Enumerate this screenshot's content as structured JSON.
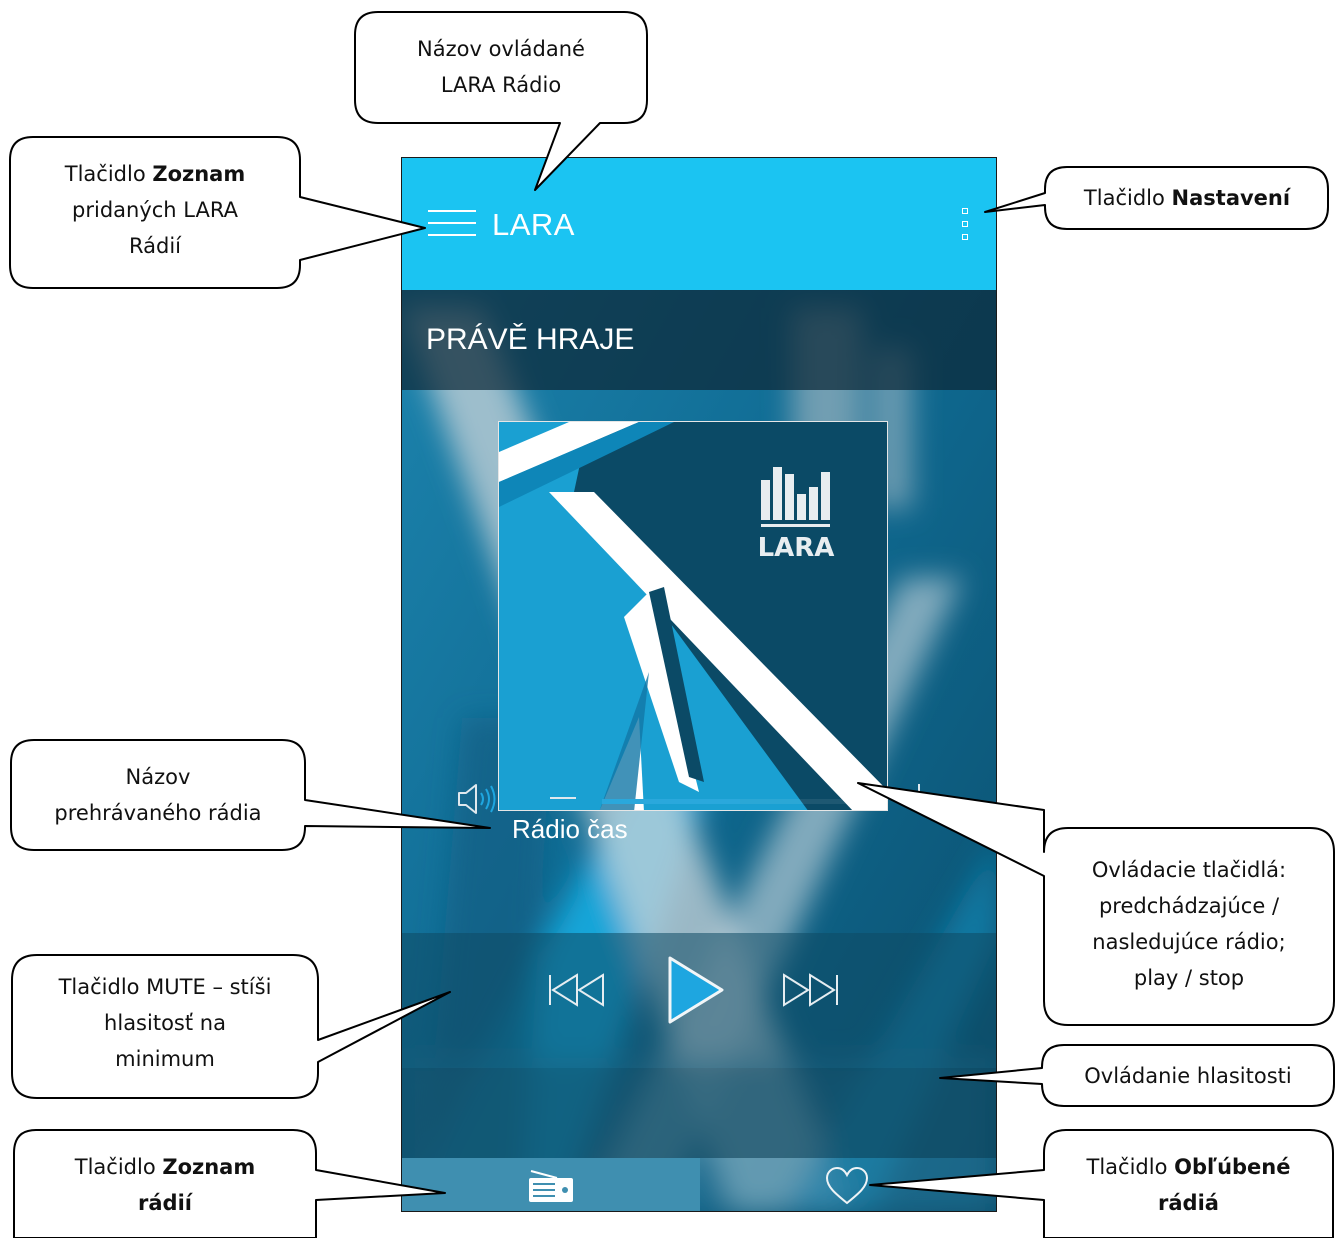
{
  "app": {
    "title": "LARA",
    "section_title": "PRÁVĚ HRAJE",
    "station_name": "Rádio čas",
    "logo_text": "LARA",
    "volume_level": 0.52,
    "icons": {
      "menu": "hamburger-icon",
      "settings": "vertical-dots-icon",
      "previous": "skip-previous-icon",
      "play": "play-icon",
      "next": "skip-next-icon",
      "mute": "speaker-icon",
      "volume_down": "minus-icon",
      "volume_up": "plus-icon",
      "radio_list": "radio-icon",
      "favorites": "heart-icon"
    },
    "colors": {
      "appbar": "#1bc4f2",
      "accent": "#2aa8dc",
      "artwork_dark": "#0b4a66",
      "artwork_light": "#1aa3d6"
    }
  },
  "callouts": {
    "title": {
      "line1": "Názov ovládané",
      "line2": "LARA Rádio"
    },
    "menu": {
      "pre1": "Tlačidlo ",
      "bold1": "Zoznam",
      "line2": "pridaných LARA",
      "line3": "Rádií"
    },
    "settings": {
      "pre1": "Tlačidlo ",
      "bold1": "Nastavení"
    },
    "station": {
      "line1": "Názov",
      "line2": "prehrávaného rádia"
    },
    "controls": {
      "line1": "Ovládacie tlačidlá:",
      "line2": "predchádzajúce /",
      "line3": "nasledujúce rádio;",
      "line4": "play / stop"
    },
    "mute": {
      "line1": "Tlačidlo MUTE – stíši",
      "line2": "hlasitosť na",
      "line3": "minimum"
    },
    "volume": {
      "line1": "Ovládanie hlasitosti"
    },
    "radio_list": {
      "pre1": "Tlačidlo ",
      "bold1": "Zoznam",
      "bold2": "rádií"
    },
    "favorites": {
      "pre1": "Tlačidlo ",
      "bold1": "Obľúbené",
      "bold2": "rádiá"
    }
  }
}
